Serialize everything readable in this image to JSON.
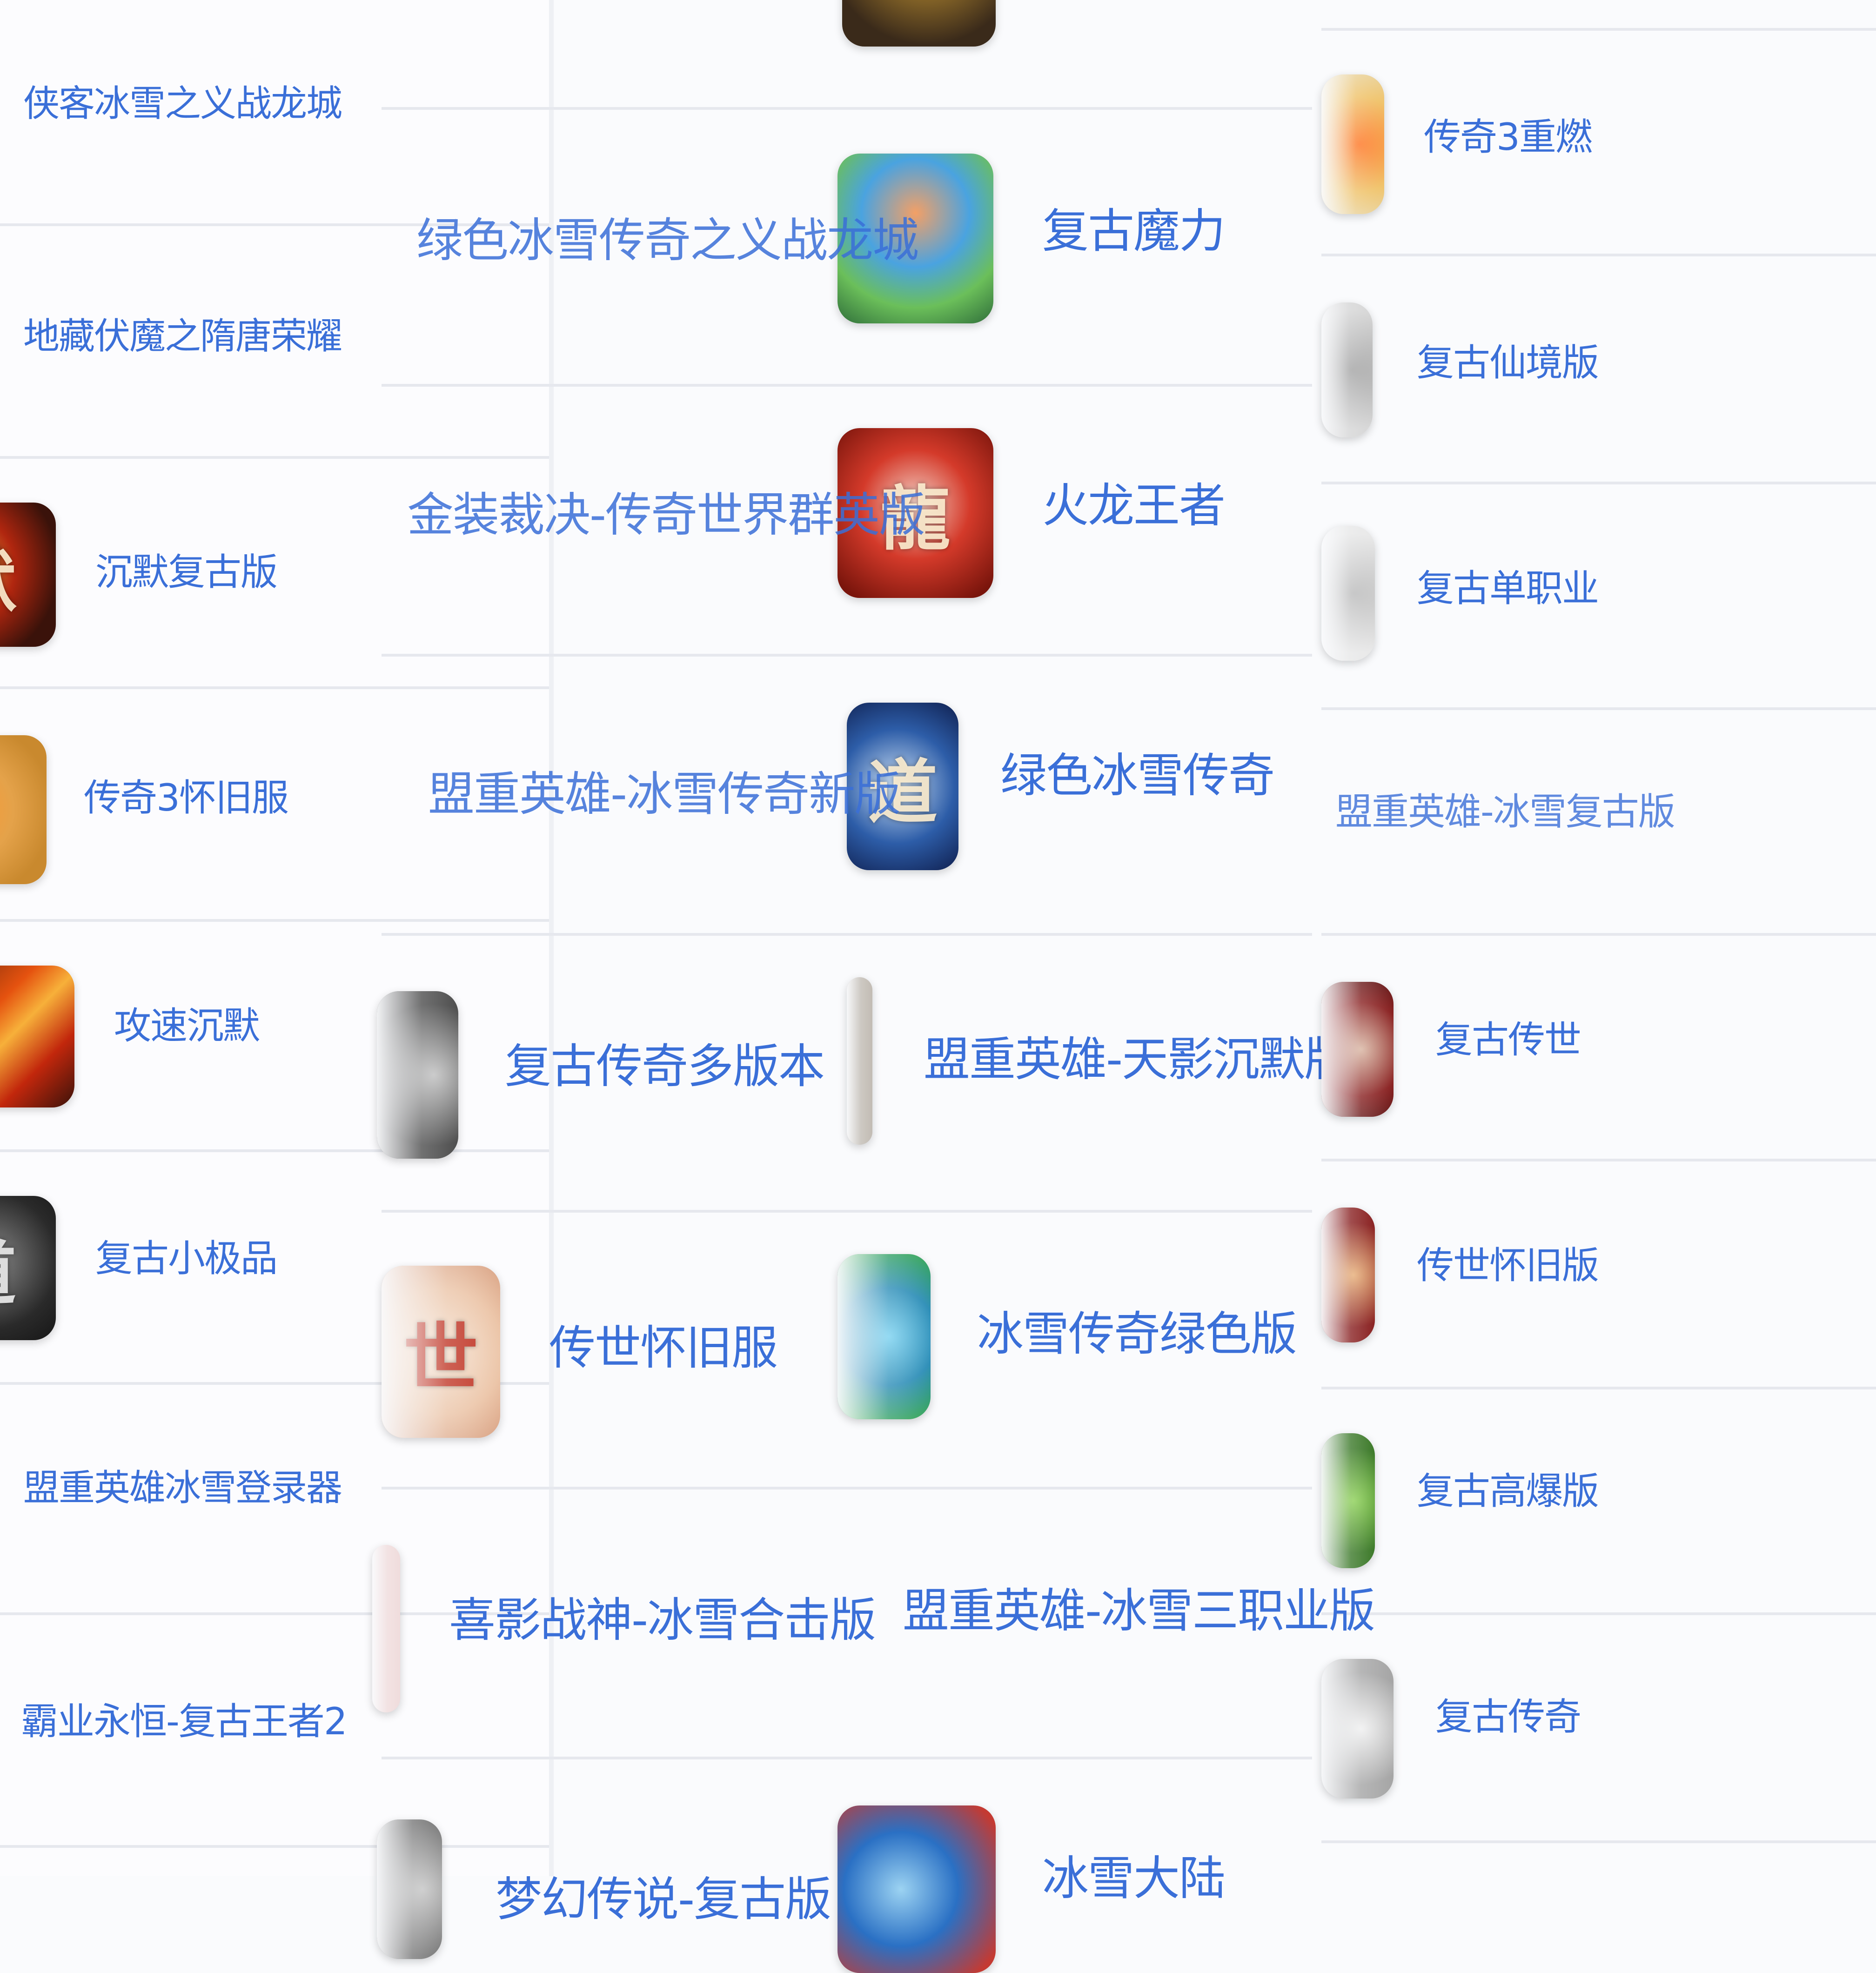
{
  "colors": {
    "link": "#3a6fd8",
    "background": "#fafbfd",
    "divider": "#e6e8ee"
  },
  "col1": [
    {
      "label": "侠客冰雪之义战龙城"
    },
    {
      "label": "地藏伏魔之隋唐荣耀"
    },
    {
      "label": "沉默复古版",
      "icon": "game-icon-silence-fire"
    },
    {
      "label": "传奇3怀旧服",
      "icon": "game-icon-legend3-gold"
    },
    {
      "label": "攻速沉默",
      "icon": "game-icon-sword-fire"
    },
    {
      "label": "复古小极品",
      "icon": "game-icon-dark-dragon"
    },
    {
      "label": "盟重英雄冰雪登录器"
    },
    {
      "label": "霸业永恒-复古王者2"
    }
  ],
  "col2": [
    {
      "label": "绿色冰雪传奇之义战龙城",
      "icon": "game-icon-cartoon-hero"
    },
    {
      "label": "金装裁决-传奇世界群英版",
      "icon": "game-icon-red-dragon"
    },
    {
      "label": "盟重英雄-冰雪传奇新版",
      "icon": "game-icon-blue-dragon"
    },
    {
      "label": "复古传奇多版本",
      "icon": "game-icon-grey-dragon"
    },
    {
      "label": "传世怀旧服",
      "icon": "game-icon-gu-shi-seal"
    },
    {
      "label": "喜影战神-冰雪合击版",
      "icon": "game-icon-pale"
    },
    {
      "label": "梦幻传说-复古版",
      "icon": "game-icon-pale-grey"
    }
  ],
  "col3": [
    {
      "label": "复古魔力"
    },
    {
      "label": "火龙王者"
    },
    {
      "label": "绿色冰雪传奇"
    },
    {
      "label": "盟重英雄-天影沉默版",
      "icon": "game-icon-dark"
    },
    {
      "label": "冰雪传奇绿色版",
      "icon": "game-icon-ice-dragon"
    },
    {
      "label": "盟重英雄-冰雪三职业版"
    },
    {
      "label": "冰雪大陆",
      "icon": "game-icon-blue-red-dragon"
    }
  ],
  "col4": [
    {
      "label": "传奇3重燃",
      "icon": "game-icon-flame-gold"
    },
    {
      "label": "复古仙境版",
      "icon": "game-icon-grey-calligraphy"
    },
    {
      "label": "复古单职业",
      "icon": "game-icon-white-dragon"
    },
    {
      "label": "盟重英雄-冰雪复古版"
    },
    {
      "label": "复古传世",
      "icon": "game-icon-red-seal"
    },
    {
      "label": "传世怀旧版",
      "icon": "game-icon-red-gold"
    },
    {
      "label": "复古高爆版",
      "icon": "game-icon-green-dragon"
    },
    {
      "label": "复古传奇",
      "icon": "game-icon-silver-dragon"
    }
  ]
}
